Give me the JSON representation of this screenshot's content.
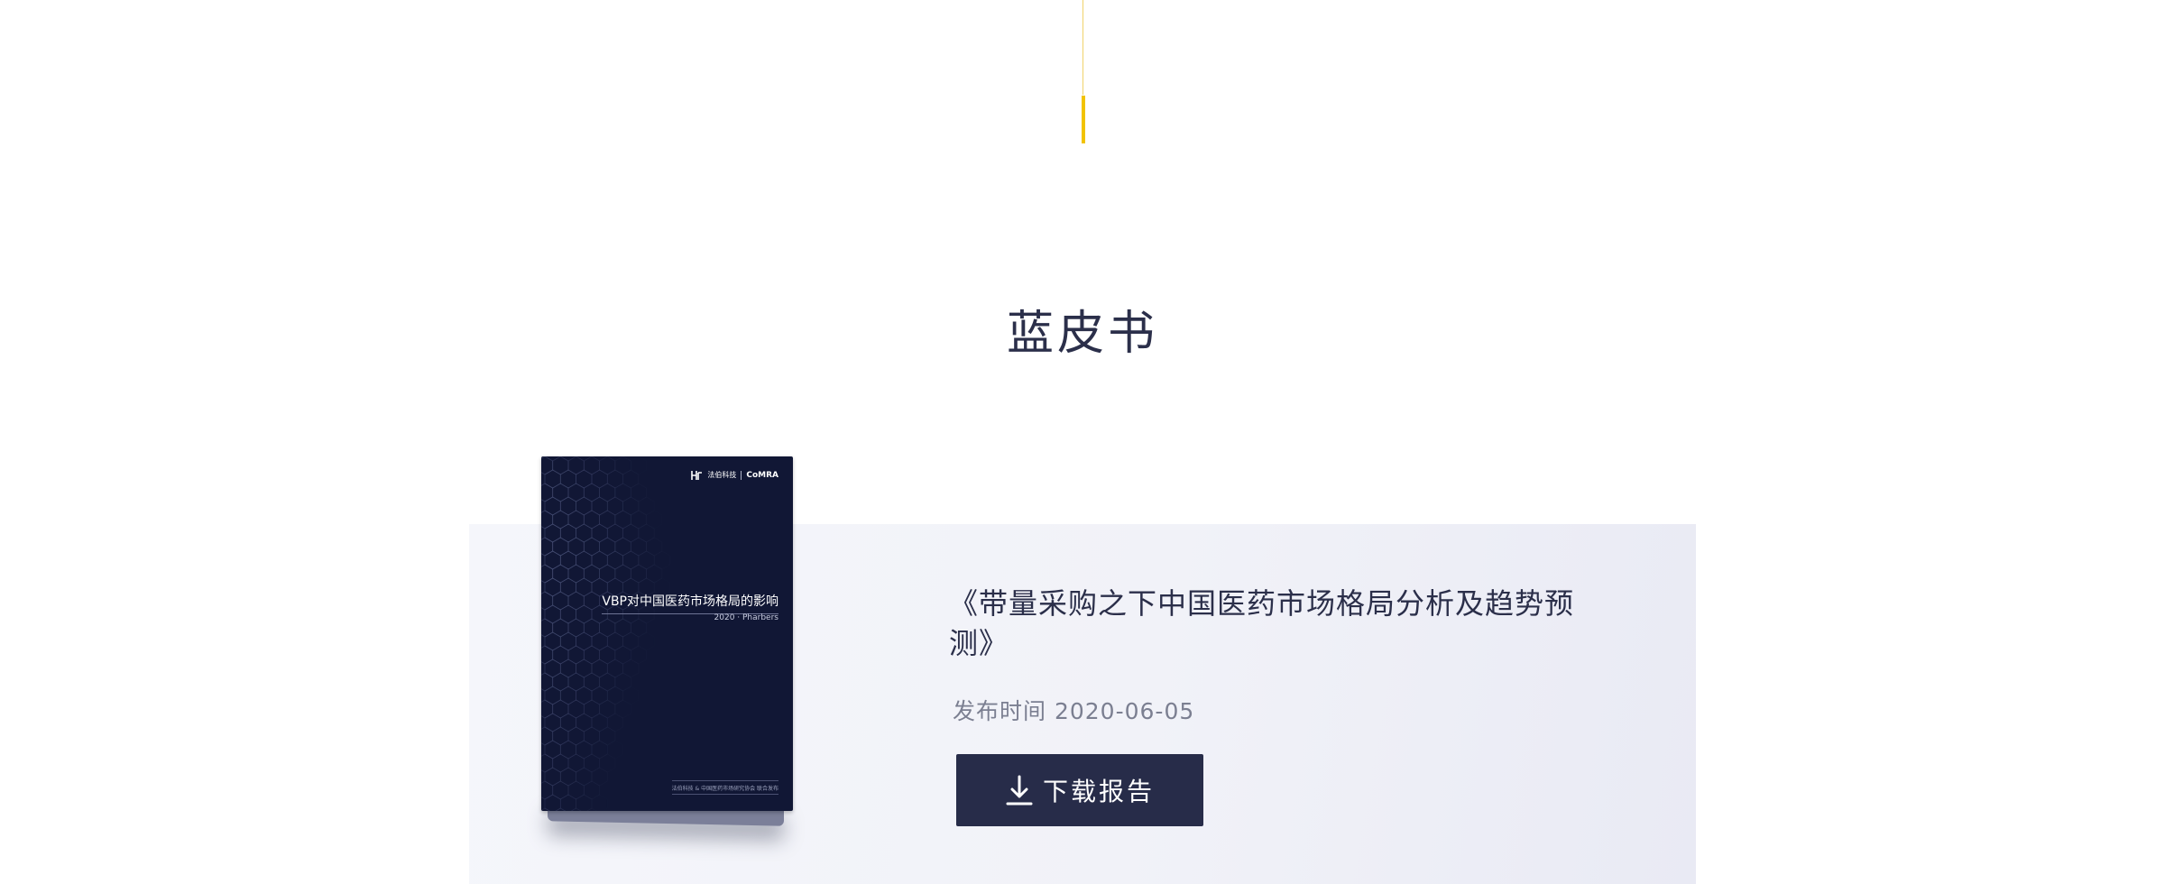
{
  "section": {
    "title": "蓝皮书"
  },
  "book_cover": {
    "brand_left": "法伯科技",
    "brand_right": "CoMRA",
    "title": "VBP对中国医药市场格局的影响",
    "subtitle": "2020 · Pharbers",
    "footer": "法伯科技 & 中国医药市场研究协会 联合发布"
  },
  "report": {
    "title": "《带量采购之下中国医药市场格局分析及趋势预测》",
    "date_label": "发布时间",
    "date": "2020-06-05",
    "download_label": "下载报告",
    "download_icon": "download-icon"
  },
  "colors": {
    "accent": "#f2c300",
    "primary": "#272c49",
    "text": "#2b2f4a",
    "muted": "#7b7f91",
    "cover": "#111735"
  }
}
